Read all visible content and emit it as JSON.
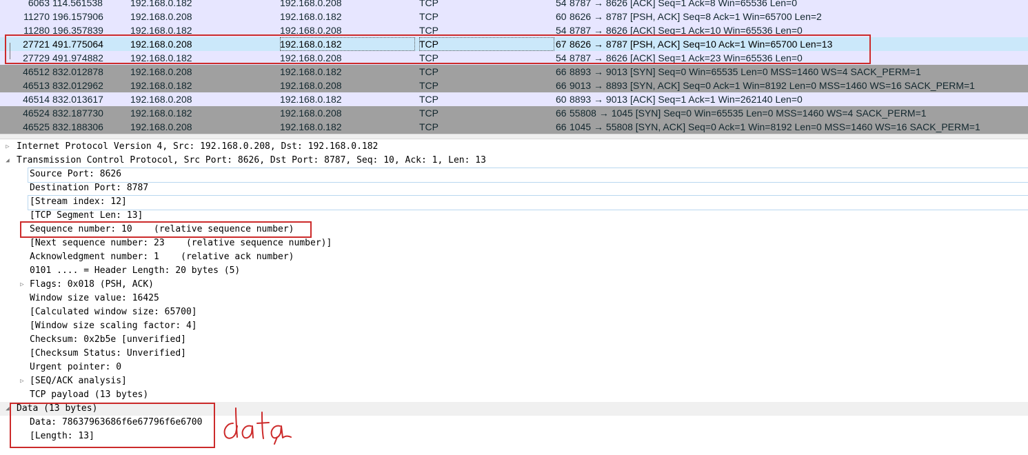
{
  "packet_list": {
    "rows": [
      {
        "no": "6063",
        "time": "114.561538",
        "src": "192.168.0.182",
        "dst": "192.168.0.208",
        "proto": "TCP",
        "len": "54",
        "info": "8787 → 8626 [ACK] Seq=1 Ack=8 Win=65536 Len=0",
        "style": "tcp"
      },
      {
        "no": "11270",
        "time": "196.157906",
        "src": "192.168.0.208",
        "dst": "192.168.0.182",
        "proto": "TCP",
        "len": "60",
        "info": "8626 → 8787 [PSH, ACK] Seq=8 Ack=1 Win=65700 Len=2",
        "style": "tcp"
      },
      {
        "no": "11280",
        "time": "196.357839",
        "src": "192.168.0.182",
        "dst": "192.168.0.208",
        "proto": "TCP",
        "len": "54",
        "info": "8787 → 8626 [ACK] Seq=1 Ack=10 Win=65536 Len=0",
        "style": "tcp"
      },
      {
        "no": "27721",
        "time": "491.775064",
        "src": "192.168.0.208",
        "dst": "192.168.0.182",
        "proto": "TCP",
        "len": "67",
        "info": "8626 → 8787 [PSH, ACK] Seq=10 Ack=1 Win=65700 Len=13",
        "style": "selected"
      },
      {
        "no": "27729",
        "time": "491.974882",
        "src": "192.168.0.182",
        "dst": "192.168.0.208",
        "proto": "TCP",
        "len": "54",
        "info": "8787 → 8626 [ACK] Seq=1 Ack=23 Win=65536 Len=0",
        "style": "tcp"
      },
      {
        "no": "46512",
        "time": "832.012878",
        "src": "192.168.0.208",
        "dst": "192.168.0.182",
        "proto": "TCP",
        "len": "66",
        "info": "8893 → 9013 [SYN] Seq=0 Win=65535 Len=0 MSS=1460 WS=4 SACK_PERM=1",
        "style": "syn"
      },
      {
        "no": "46513",
        "time": "832.012962",
        "src": "192.168.0.182",
        "dst": "192.168.0.208",
        "proto": "TCP",
        "len": "66",
        "info": "9013 → 8893 [SYN, ACK] Seq=0 Ack=1 Win=8192 Len=0 MSS=1460 WS=16 SACK_PERM=1",
        "style": "syn"
      },
      {
        "no": "46514",
        "time": "832.013617",
        "src": "192.168.0.208",
        "dst": "192.168.0.182",
        "proto": "TCP",
        "len": "60",
        "info": "8893 → 9013 [ACK] Seq=1 Ack=1 Win=262140 Len=0",
        "style": "tcp"
      },
      {
        "no": "46524",
        "time": "832.187730",
        "src": "192.168.0.182",
        "dst": "192.168.0.208",
        "proto": "TCP",
        "len": "66",
        "info": "55808 → 1045 [SYN] Seq=0 Win=65535 Len=0 MSS=1460 WS=4 SACK_PERM=1",
        "style": "syn"
      },
      {
        "no": "46525",
        "time": "832.188306",
        "src": "192.168.0.208",
        "dst": "192.168.0.182",
        "proto": "TCP",
        "len": "66",
        "info": "1045 → 55808 [SYN, ACK] Seq=0 Ack=1 Win=8192 Len=0 MSS=1460 WS=16 SACK_PERM=1",
        "style": "syn"
      }
    ]
  },
  "details": {
    "rows": [
      {
        "text": "Internet Protocol Version 4, Src: 192.168.0.208, Dst: 192.168.0.182",
        "level": 0,
        "toggle": "collapsed"
      },
      {
        "text": "Transmission Control Protocol, Src Port: 8626, Dst Port: 8787, Seq: 10, Ack: 1, Len: 13",
        "level": 0,
        "toggle": "expanded"
      },
      {
        "text": "Source Port: 8626",
        "level": 1,
        "toggle": "none"
      },
      {
        "text": "Destination Port: 8787",
        "level": 1,
        "toggle": "none"
      },
      {
        "text": "[Stream index: 12]",
        "level": 1,
        "toggle": "none"
      },
      {
        "text": "[TCP Segment Len: 13]",
        "level": 1,
        "toggle": "none"
      },
      {
        "text": "Sequence number: 10    (relative sequence number)",
        "level": 1,
        "toggle": "none"
      },
      {
        "text": "[Next sequence number: 23    (relative sequence number)]",
        "level": 1,
        "toggle": "none"
      },
      {
        "text": "Acknowledgment number: 1    (relative ack number)",
        "level": 1,
        "toggle": "none"
      },
      {
        "text": "0101 .... = Header Length: 20 bytes (5)",
        "level": 1,
        "toggle": "none"
      },
      {
        "text": "Flags: 0x018 (PSH, ACK)",
        "level": 1,
        "toggle": "collapsed"
      },
      {
        "text": "Window size value: 16425",
        "level": 1,
        "toggle": "none"
      },
      {
        "text": "[Calculated window size: 65700]",
        "level": 1,
        "toggle": "none"
      },
      {
        "text": "[Window size scaling factor: 4]",
        "level": 1,
        "toggle": "none"
      },
      {
        "text": "Checksum: 0x2b5e [unverified]",
        "level": 1,
        "toggle": "none"
      },
      {
        "text": "[Checksum Status: Unverified]",
        "level": 1,
        "toggle": "none"
      },
      {
        "text": "Urgent pointer: 0",
        "level": 1,
        "toggle": "none"
      },
      {
        "text": "[SEQ/ACK analysis]",
        "level": 1,
        "toggle": "collapsed"
      },
      {
        "text": "TCP payload (13 bytes)",
        "level": 1,
        "toggle": "none"
      },
      {
        "text": "Data (13 bytes)",
        "level": 0,
        "toggle": "expanded"
      },
      {
        "text": "Data: 78637963686f6e67796f6e6700",
        "level": 1,
        "toggle": "none"
      },
      {
        "text": "[Length: 13]",
        "level": 1,
        "toggle": "none"
      }
    ]
  },
  "annotation": {
    "handwritten_label": "data",
    "color": "#cc2a2a"
  }
}
